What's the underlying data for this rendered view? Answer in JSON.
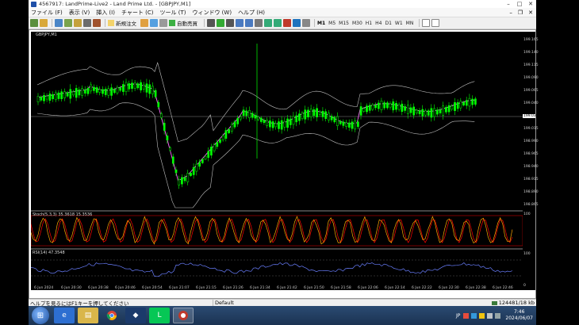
{
  "window": {
    "title": "4567917: LandPrime-Live2 - Land Prime Ltd. - [GBPJPY,M1]"
  },
  "menu": {
    "items": [
      "ファイル (F)",
      "表示 (V)",
      "挿入 (I)",
      "チャート (C)",
      "ツール (T)",
      "ウィンドウ (W)",
      "ヘルプ (H)"
    ]
  },
  "toolbar": {
    "new_order": "新規注文",
    "auto_trading": "自動売買",
    "timeframes": [
      "M1",
      "M5",
      "M15",
      "M30",
      "H1",
      "H4",
      "D1",
      "W1",
      "MN"
    ],
    "active_timeframe": "M1"
  },
  "chart": {
    "symbol_label": "GBPJPY,M1",
    "stoch_label": "Stoch(5,3,3) 35.3618 15.3536",
    "rsi_label": "RSI(14) 47.3548",
    "price_ticks": [
      "199.165",
      "199.140",
      "199.115",
      "199.090",
      "199.065",
      "199.040",
      "199.032",
      "199.015",
      "198.990",
      "198.965",
      "198.940",
      "198.915",
      "198.890",
      "198.865"
    ],
    "current_price": "199.032",
    "stoch_ticks": [
      "100",
      "80",
      "20",
      "0"
    ],
    "rsi_ticks": [
      "100",
      "70",
      "30",
      "0"
    ],
    "time_ticks": [
      "6 Jun 2024",
      "6 Jun 20:30",
      "6 Jun 20:38",
      "6 Jun 20:46",
      "6 Jun 20:54",
      "6 Jun 21:07",
      "6 Jun 21:15",
      "6 Jun 21:26",
      "6 Jun 21:34",
      "6 Jun 21:42",
      "6 Jun 21:50",
      "6 Jun 21:58",
      "6 Jun 22:06",
      "6 Jun 22:14",
      "6 Jun 22:22",
      "6 Jun 22:30",
      "6 Jun 22:38",
      "6 Jun 22:46"
    ],
    "colors": {
      "background": "#000000",
      "bull": "#00ff00",
      "bear": "#00ff00",
      "bands": "#c0c0c0",
      "ma": "#ff66ff",
      "stoch_main": "#ffa500",
      "stoch_signal": "#ff0000",
      "rsi": "#6a7fff"
    }
  },
  "status": {
    "help": "ヘルプを見るにはF1キーを押してください",
    "profile": "Default",
    "traffic": "124481/18 kb"
  },
  "taskbar": {
    "clock_time": "7:46",
    "clock_date": "2024/06/07",
    "lang": "JP"
  }
}
